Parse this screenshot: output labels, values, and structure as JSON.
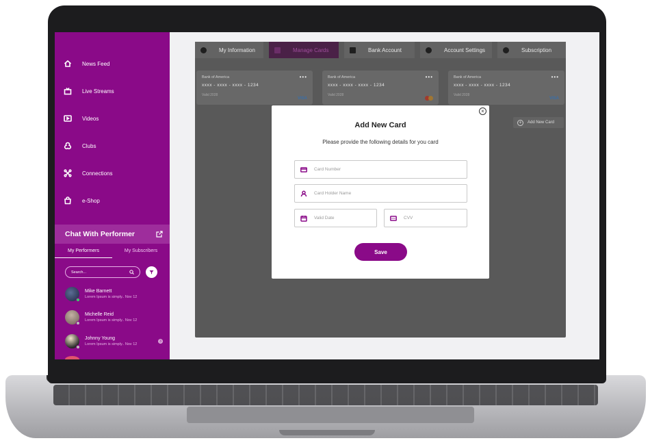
{
  "sidebar": {
    "nav": [
      {
        "label": "News Feed",
        "icon": "home-icon"
      },
      {
        "label": "Live Streams",
        "icon": "live-stream-icon"
      },
      {
        "label": "Videos",
        "icon": "video-icon"
      },
      {
        "label": "Clubs",
        "icon": "clubs-icon"
      },
      {
        "label": "Connections",
        "icon": "connections-icon"
      },
      {
        "label": "e-Shop",
        "icon": "shop-icon"
      }
    ],
    "chat": {
      "title": "Chat With Performer",
      "tabs": [
        "My Performers",
        "My Subscribers"
      ],
      "search_placeholder": "Search...",
      "contacts": [
        {
          "name": "Mike Barnett",
          "message": "Lorem Ipsum is simply.. Nov 12"
        },
        {
          "name": "Michelle Reid",
          "message": "Lorem Ipsum is simply.. Nov 12"
        },
        {
          "name": "Johnny Young",
          "message": "Lorem Ipsum is simply.. Nov 12",
          "unread": "3"
        }
      ]
    }
  },
  "tabs": [
    "My Information",
    "Manage Cards",
    "Bank Account",
    "Account Settings",
    "Subscription"
  ],
  "cards": [
    {
      "bank": "Bank of America",
      "number": "xxxx - xxxx - xxxx - 1234",
      "expiry": "Valid 2028",
      "brand": "VISA"
    },
    {
      "bank": "Bank of America",
      "number": "xxxx - xxxx - xxxx - 1234",
      "expiry": "Valid 2028",
      "brand": "mastercard"
    },
    {
      "bank": "Bank of America",
      "number": "xxxx - xxxx - xxxx - 1234",
      "expiry": "Valid 2028",
      "brand": "VISA"
    }
  ],
  "card_menu": "•••",
  "add_card_label": "Add New Card",
  "modal": {
    "title": "Add New Card",
    "subtitle": "Please provide the following details for you card",
    "close": "×",
    "fields": {
      "card_number": "Card Number",
      "holder_name": "Card Holder Name",
      "valid_date": "Valid Date",
      "cvv": "CVV"
    },
    "save": "Save"
  },
  "colors": {
    "brand": "#8a0a88",
    "overlay": "#595959"
  }
}
